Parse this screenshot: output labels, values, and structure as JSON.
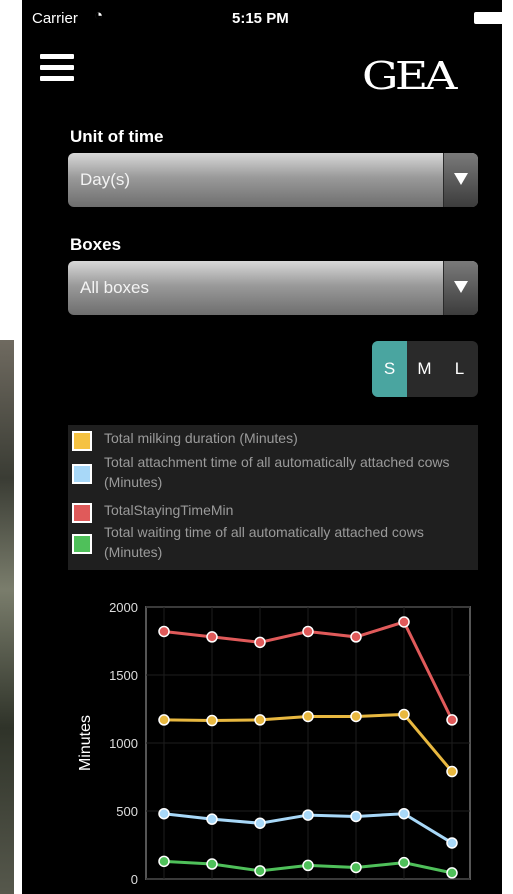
{
  "status_bar": {
    "carrier": "Carrier",
    "time": "5:15 PM"
  },
  "header": {
    "logo": "GEA"
  },
  "filters": {
    "unit_of_time": {
      "label": "Unit of time",
      "value": "Day(s)"
    },
    "boxes": {
      "label": "Boxes",
      "value": "All boxes"
    }
  },
  "size_toggle": {
    "options": [
      "S",
      "M",
      "L"
    ],
    "selected": "S",
    "selected_color": "#4aa5a0"
  },
  "legend": [
    {
      "label": "Total milking duration (Minutes)",
      "color": "#f5c242"
    },
    {
      "label": "Total attachment time of all automatically attached cows (Minutes)",
      "color": "#a8d8f8"
    },
    {
      "label": "TotalStayingTimeMin",
      "color": "#e05a5a"
    },
    {
      "label": "Total waiting time of all automatically attached cows (Minutes)",
      "color": "#4fc05a"
    }
  ],
  "chart_data": {
    "type": "line",
    "x": [
      1,
      2,
      3,
      4,
      5,
      6,
      7
    ],
    "ylabel": "Minutes",
    "ylim": [
      0,
      2000
    ],
    "yticks": [
      "0",
      "500",
      "1000",
      "1500",
      "2000"
    ],
    "grid": true,
    "series": [
      {
        "color": "#e05a5a",
        "values": [
          1820,
          1780,
          1740,
          1820,
          1780,
          1890,
          1170
        ]
      },
      {
        "color": "#e8b840",
        "values": [
          1170,
          1165,
          1170,
          1195,
          1195,
          1210,
          790
        ]
      },
      {
        "color": "#a8d8f8",
        "values": [
          480,
          440,
          410,
          470,
          460,
          480,
          265
        ]
      },
      {
        "color": "#4fc05a",
        "values": [
          130,
          110,
          60,
          100,
          85,
          120,
          45
        ]
      }
    ]
  }
}
